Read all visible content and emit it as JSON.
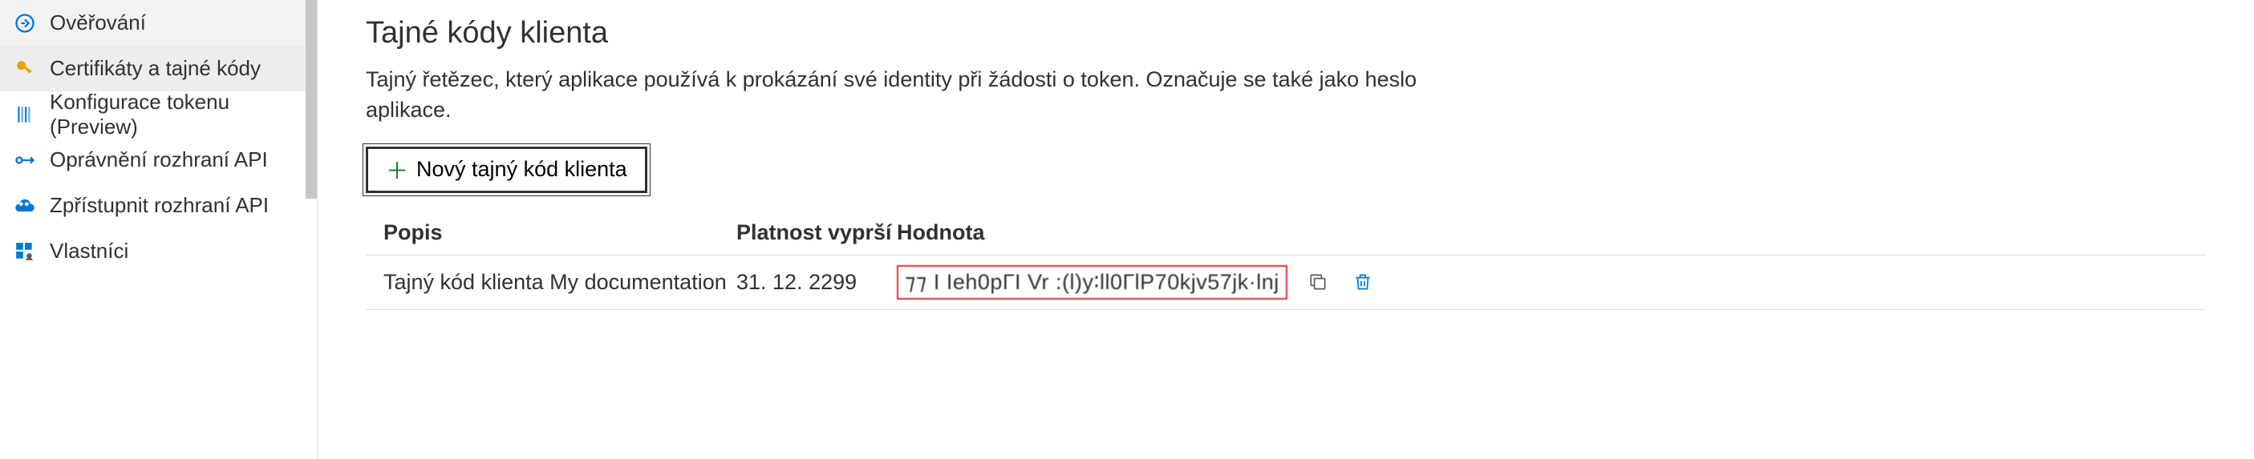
{
  "sidebar": {
    "items": [
      {
        "label": "Ověřování",
        "icon": "auth"
      },
      {
        "label": "Certifikáty a tajné kódy",
        "icon": "key",
        "active": true
      },
      {
        "label": "Konfigurace tokenu (Preview)",
        "icon": "token"
      },
      {
        "label": "Oprávnění rozhraní API",
        "icon": "api-perm"
      },
      {
        "label": "Zpřístupnit rozhraní API",
        "icon": "expose-api"
      },
      {
        "label": "Vlastníci",
        "icon": "owners"
      }
    ]
  },
  "main": {
    "title": "Tajné kódy klienta",
    "description": "Tajný řetězec, který aplikace používá k prokázání své identity při žádosti o token. Označuje se také jako heslo aplikace.",
    "add_button_label": "Nový tajný kód klienta",
    "table": {
      "headers": {
        "description": "Popis",
        "expires": "Platnost vyprší",
        "value": "Hodnota"
      },
      "rows": [
        {
          "description": "Tajný kód klienta My documentation",
          "expires": "31. 12. 2299",
          "value": "⁊⁊ I Ieh0pГI Vr :(l)y∶ll0ГlP70kjv57jk·lnj"
        }
      ]
    }
  }
}
